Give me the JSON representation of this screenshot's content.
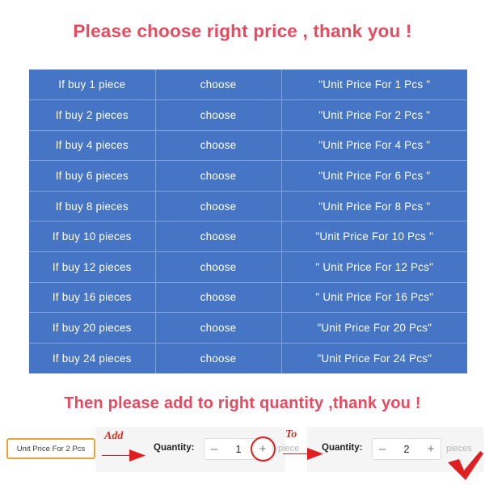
{
  "headings": {
    "top": "Please choose right price , thank you !",
    "middle": "Then please add to right quantity ,thank you !"
  },
  "colors": {
    "heading_red": "#e8495f",
    "table_blue": "#4575c4",
    "table_grid": "#7fa3dc",
    "chip_border_orange": "#e8a33d",
    "annotation_red": "#d93025",
    "highlight_red": "#e02020",
    "panel_bg": "#f5f5f5"
  },
  "price_table": {
    "columns": [
      "quantity",
      "action",
      "price_option"
    ],
    "rows": [
      {
        "quantity": "If buy  1  piece",
        "action": "choose",
        "price_option": "\"Unit Price For  1  Pcs \""
      },
      {
        "quantity": "If buy  2  pieces",
        "action": "choose",
        "price_option": "\"Unit Price For  2  Pcs \""
      },
      {
        "quantity": "If buy  4  pieces",
        "action": "choose",
        "price_option": "\"Unit Price For  4 Pcs \""
      },
      {
        "quantity": "If buy  6  pieces",
        "action": "choose",
        "price_option": "\"Unit Price For  6  Pcs \""
      },
      {
        "quantity": "If  buy  8  pieces",
        "action": "choose",
        "price_option": "\"Unit Price For  8  Pcs \""
      },
      {
        "quantity": "If buy  10  pieces",
        "action": "choose",
        "price_option": "\"Unit Price For  10  Pcs \""
      },
      {
        "quantity": "If buy  12  pieces",
        "action": "choose",
        "price_option": "\" Unit Price For  12 Pcs\""
      },
      {
        "quantity": "If buy  16  pieces",
        "action": "choose",
        "price_option": "\" Unit Price For  16 Pcs\""
      },
      {
        "quantity": "If buy  20  pieces",
        "action": "choose",
        "price_option": "\"Unit Price For  20  Pcs\""
      },
      {
        "quantity": "If buy  24  pieces",
        "action": "choose",
        "price_option": "\"Unit Price For  24  Pcs\""
      }
    ]
  },
  "bottom": {
    "unit_price_chip": "Unit Price For 2 Pcs",
    "annotation_add": "Add",
    "annotation_to": "To",
    "stepper_left": {
      "label": "Quantity:",
      "minus": "–",
      "value": "1",
      "plus": "+",
      "unit": "piece"
    },
    "stepper_right": {
      "label": "Quantity:",
      "minus": "–",
      "value": "2",
      "plus": "+",
      "unit": "pieces"
    }
  }
}
